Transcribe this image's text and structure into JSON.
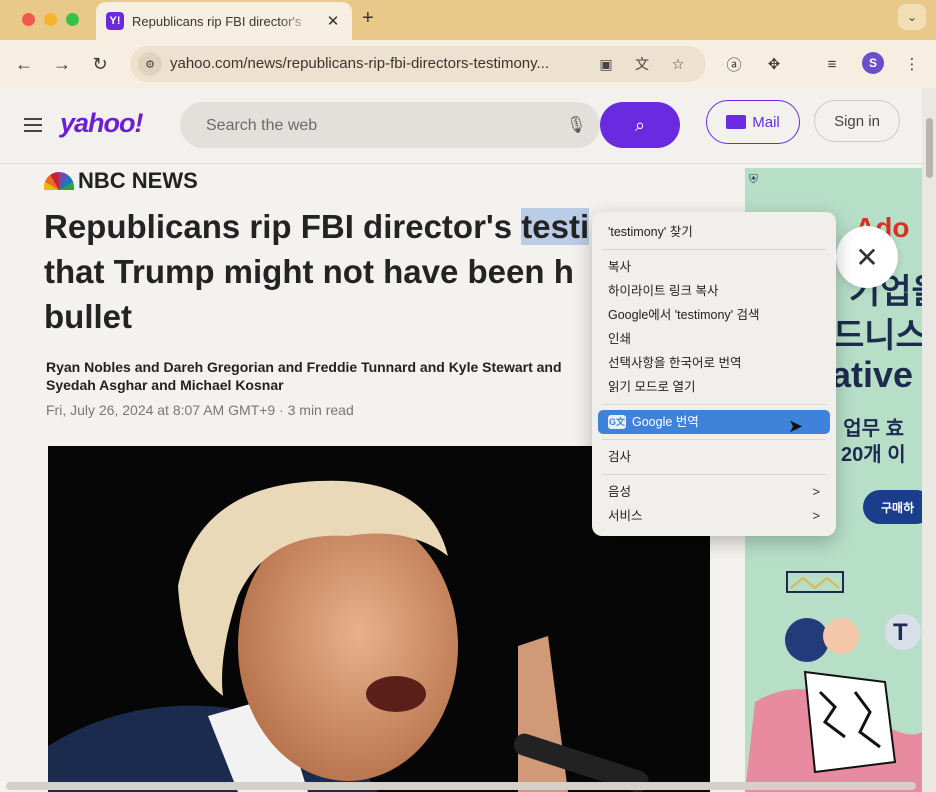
{
  "browser": {
    "tab_title": "Republicans rip FBI director's",
    "tab_favicon": "Y!",
    "url": "yahoo.com/news/republicans-rip-fbi-directors-testimony...",
    "profile_initial": "S",
    "new_tab": "+"
  },
  "yahoo": {
    "logo": "yahoo!",
    "search_placeholder": "Search the web",
    "mail_label": "Mail",
    "signin_label": "Sign in"
  },
  "article": {
    "source": "NBC NEWS",
    "headline_part1": "Republicans rip FBI director's ",
    "headline_highlight": "testi",
    "headline_part2": "that Trump might not have been h",
    "headline_part3": "bullet",
    "byline": "Ryan Nobles and Dareh Gregorian and Freddie Tunnard and Kyle Stewart and Syedah Asghar and Michael Kosnar",
    "date": "Fri, July 26, 2024 at 8:07 AM GMT+9 · 3 min read"
  },
  "ad": {
    "line1": "Ado",
    "line2": "기업을",
    "line3": "드니스",
    "line4": "ative",
    "line5": "! 업무 효",
    "line6": "20개 이",
    "cta": "구매하"
  },
  "context_menu": {
    "find": "'testimony' 찾기",
    "copy": "복사",
    "copy_link_highlight": "하이라이트 링크 복사",
    "google_search": "Google에서 'testimony' 검색",
    "print": "인쇄",
    "translate_selection": "선택사항을 한국어로 번역",
    "reading_mode": "읽기 모드로 열기",
    "google_translate": "Google 번역",
    "inspect": "검사",
    "speech": "음성",
    "services": "서비스"
  }
}
